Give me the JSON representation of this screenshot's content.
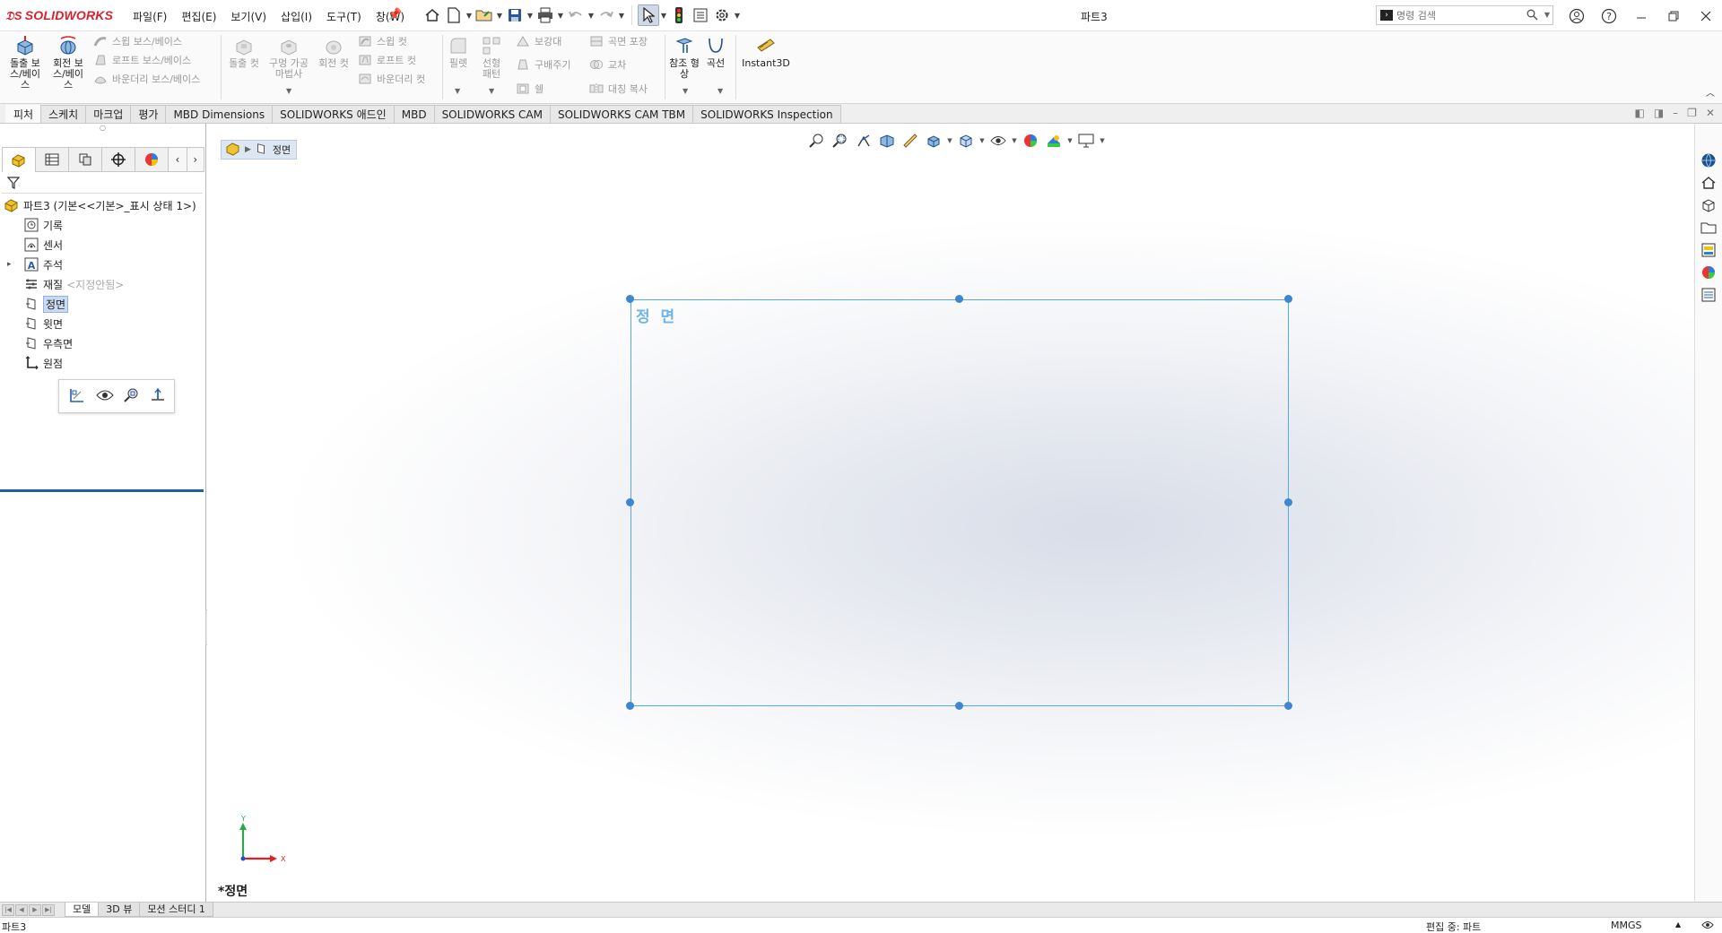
{
  "app": {
    "logo_text": "SOLIDWORKS",
    "document_title": "파트3"
  },
  "menus": [
    "파일(F)",
    "편집(E)",
    "보기(V)",
    "삽입(I)",
    "도구(T)",
    "창(W)"
  ],
  "search": {
    "placeholder": "명령 검색"
  },
  "ribbon": {
    "extrude_boss": "돌출 보스/베이스",
    "revolve_boss": "회전 보스/베이스",
    "sweep_boss": "스윕 보스/베이스",
    "loft_boss": "로프트 보스/베이스",
    "boundary_boss": "바운더리 보스/베이스",
    "extrude_cut": "돌출 컷",
    "hole_wizard": "구멍 가공 마법사",
    "revolve_cut": "회전 컷",
    "sweep_cut": "스윕 컷",
    "loft_cut": "로프트 컷",
    "boundary_cut": "바운더리 컷",
    "fillet": "필렛",
    "linear_pattern": "선형 패턴",
    "rib": "보강대",
    "draft": "구배주기",
    "shell": "쉘",
    "wrap": "곡면 포장",
    "intersect": "교차",
    "mirror": "대칭 복사",
    "reference_geometry": "참조 형상",
    "curves": "곡선",
    "instant3d": "Instant3D"
  },
  "command_tabs": [
    "피처",
    "스케치",
    "마크업",
    "평가",
    "MBD Dimensions",
    "SOLIDWORKS 애드인",
    "MBD",
    "SOLIDWORKS CAM",
    "SOLIDWORKS CAM TBM",
    "SOLIDWORKS Inspection"
  ],
  "tree": {
    "root": "파트3  (기본<<기본>_표시 상태 1>)",
    "history": "기록",
    "sensors": "센서",
    "annotations": "주석",
    "material": "재질",
    "material_placeholder": "<지정안됨>",
    "front_plane": "정면",
    "top_plane": "윗면",
    "right_plane": "우측면",
    "origin": "원점"
  },
  "viewport": {
    "breadcrumb_label": "정면",
    "plane_label": "정 면",
    "view_name": "*정면",
    "triad_y": "Y",
    "triad_x": "X"
  },
  "bottom_tabs": [
    "모델",
    "3D 뷰",
    "모션 스터디 1"
  ],
  "status": {
    "left": "파트3",
    "editing": "편집 중: 파트",
    "units": "MMGS"
  },
  "colors": {
    "brand_red": "#d7202d",
    "plane_border": "#5aa6e6",
    "handle": "#3d86d0",
    "selection": "#c9daf2"
  }
}
